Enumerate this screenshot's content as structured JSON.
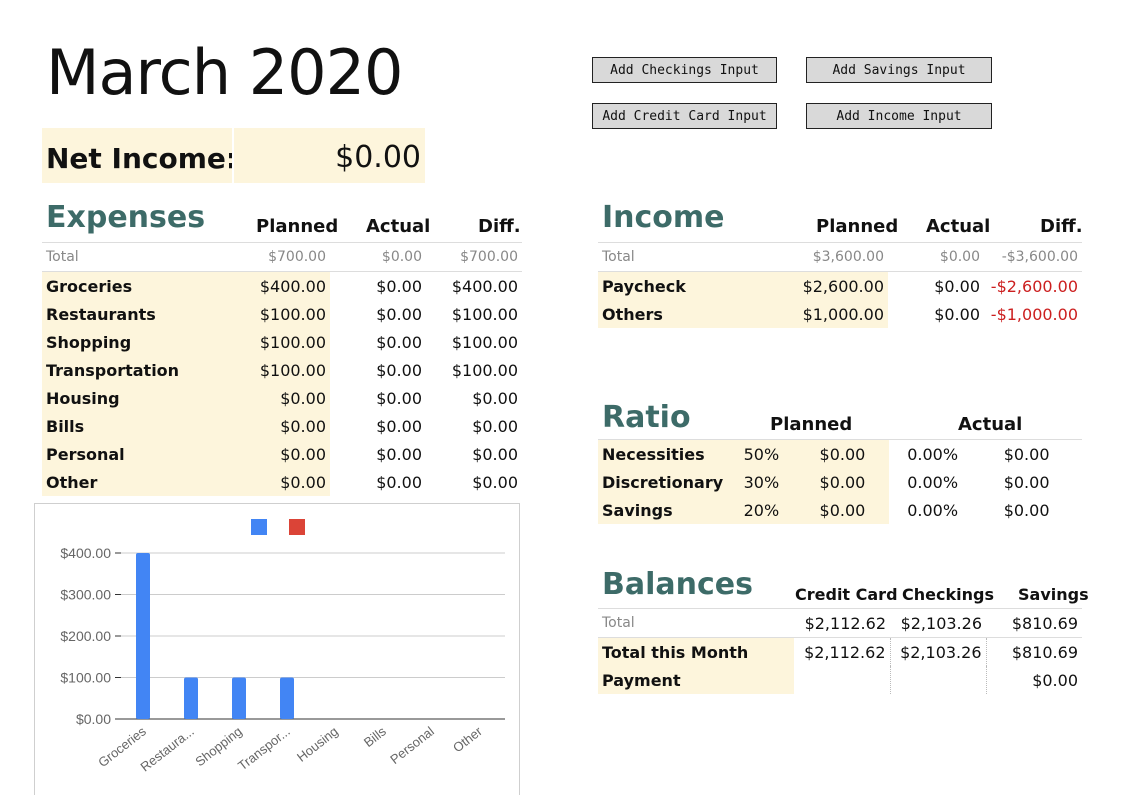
{
  "title": "March 2020",
  "buttons": {
    "checkings": "Add Checkings Input",
    "savings": "Add Savings Input",
    "credit": "Add Credit Card Input",
    "income": "Add Income Input"
  },
  "net_income": {
    "label": "Net Income:",
    "value": "$0.00"
  },
  "expenses": {
    "title": "Expenses",
    "headers": [
      "Planned",
      "Actual",
      "Diff."
    ],
    "total": {
      "name": "Total",
      "planned": "$700.00",
      "actual": "$0.00",
      "diff": "$700.00"
    },
    "rows": [
      {
        "name": "Groceries",
        "planned": "$400.00",
        "actual": "$0.00",
        "diff": "$400.00"
      },
      {
        "name": "Restaurants",
        "planned": "$100.00",
        "actual": "$0.00",
        "diff": "$100.00"
      },
      {
        "name": "Shopping",
        "planned": "$100.00",
        "actual": "$0.00",
        "diff": "$100.00"
      },
      {
        "name": "Transportation",
        "planned": "$100.00",
        "actual": "$0.00",
        "diff": "$100.00"
      },
      {
        "name": "Housing",
        "planned": "$0.00",
        "actual": "$0.00",
        "diff": "$0.00"
      },
      {
        "name": "Bills",
        "planned": "$0.00",
        "actual": "$0.00",
        "diff": "$0.00"
      },
      {
        "name": "Personal",
        "planned": "$0.00",
        "actual": "$0.00",
        "diff": "$0.00"
      },
      {
        "name": "Other",
        "planned": "$0.00",
        "actual": "$0.00",
        "diff": "$0.00"
      }
    ]
  },
  "income": {
    "title": "Income",
    "headers": [
      "Planned",
      "Actual",
      "Diff."
    ],
    "total": {
      "name": "Total",
      "planned": "$3,600.00",
      "actual": "$0.00",
      "diff": "-$3,600.00"
    },
    "rows": [
      {
        "name": "Paycheck",
        "planned": "$2,600.00",
        "actual": "$0.00",
        "diff": "-$2,600.00"
      },
      {
        "name": "Others",
        "planned": "$1,000.00",
        "actual": "$0.00",
        "diff": "-$1,000.00"
      }
    ]
  },
  "ratio": {
    "title": "Ratio",
    "headers": [
      "Planned",
      "Actual"
    ],
    "rows": [
      {
        "name": "Necessities",
        "pct": "50%",
        "planned": "$0.00",
        "actual_pct": "0.00%",
        "actual": "$0.00"
      },
      {
        "name": "Discretionary",
        "pct": "30%",
        "planned": "$0.00",
        "actual_pct": "0.00%",
        "actual": "$0.00"
      },
      {
        "name": "Savings",
        "pct": "20%",
        "planned": "$0.00",
        "actual_pct": "0.00%",
        "actual": "$0.00"
      }
    ]
  },
  "balances": {
    "title": "Balances",
    "headers": [
      "Credit Card",
      "Checkings",
      "Savings"
    ],
    "total": {
      "name": "Total",
      "credit": "$2,112.62",
      "checkings": "$2,103.26",
      "savings": "$810.69"
    },
    "rows": [
      {
        "name": "Total this Month",
        "credit": "$2,112.62",
        "checkings": "$2,103.26",
        "savings": "$810.69"
      },
      {
        "name": "Payment",
        "credit": "",
        "checkings": "",
        "savings": "$0.00"
      }
    ]
  },
  "chart_data": {
    "type": "bar",
    "categories": [
      "Groceries",
      "Restaura...",
      "Shopping",
      "Transpor...",
      "Housing",
      "Bills",
      "Personal",
      "Other"
    ],
    "series": [
      {
        "values": [
          400,
          100,
          100,
          100,
          0,
          0,
          0,
          0
        ],
        "color": "#4285f4"
      },
      {
        "values": [
          0,
          0,
          0,
          0,
          0,
          0,
          0,
          0
        ],
        "color": "#db4437"
      }
    ],
    "yticks": [
      "$0.00",
      "$100.00",
      "$200.00",
      "$300.00",
      "$400.00"
    ],
    "ylim": [
      0,
      400
    ],
    "grid": true,
    "legend": "top"
  }
}
